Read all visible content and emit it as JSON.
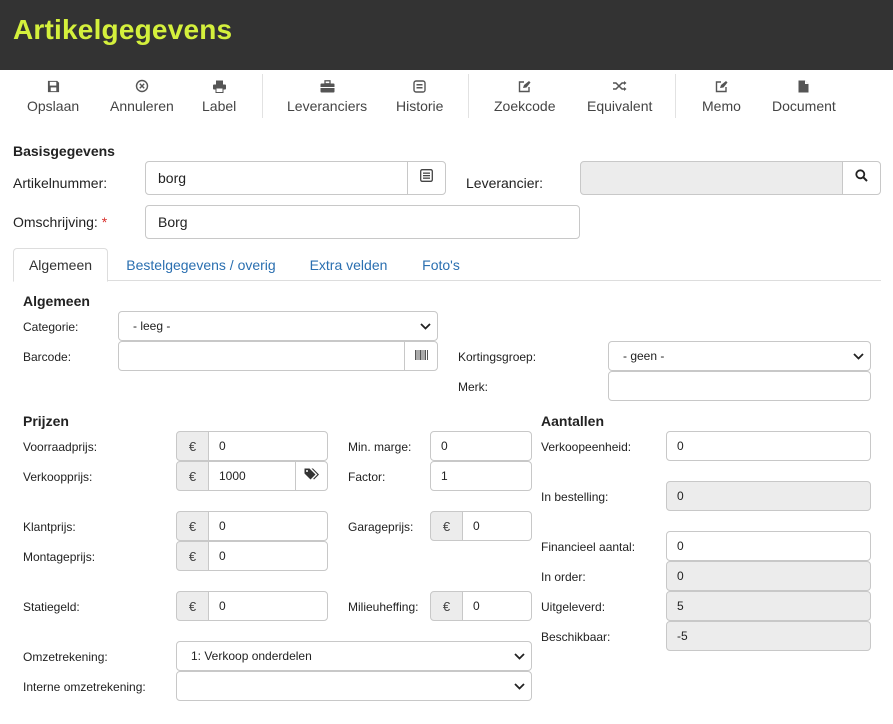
{
  "header": {
    "title": "Artikelgegevens"
  },
  "toolbar": {
    "save": "Opslaan",
    "cancel": "Annuleren",
    "label": "Label",
    "suppliers": "Leveranciers",
    "history": "Historie",
    "search_code": "Zoekcode",
    "equivalent": "Equivalent",
    "memo": "Memo",
    "document": "Document"
  },
  "basis": {
    "heading": "Basisgegevens",
    "article_number_label": "Artikelnummer:",
    "article_number_value": "borg",
    "supplier_label": "Leverancier:",
    "supplier_value": "",
    "description_label": "Omschrijving:",
    "required_mark": "*",
    "description_value": "Borg"
  },
  "tabs": {
    "general": "Algemeen",
    "order_data": "Bestelgegevens / overig",
    "extra_fields": "Extra velden",
    "photos": "Foto's"
  },
  "general": {
    "heading": "Algemeen",
    "category_label": "Categorie:",
    "category_value": "- leeg -",
    "barcode_label": "Barcode:",
    "barcode_value": "",
    "discount_group_label": "Kortingsgroep:",
    "discount_group_value": "- geen -",
    "brand_label": "Merk:",
    "brand_value": ""
  },
  "prices": {
    "heading": "Prijzen",
    "currency": "€",
    "stock_price_label": "Voorraadprijs:",
    "stock_price_value": "0",
    "sale_price_label": "Verkoopprijs:",
    "sale_price_value": "1000",
    "min_margin_label": "Min. marge:",
    "min_margin_value": "0",
    "factor_label": "Factor:",
    "factor_value": "1",
    "customer_price_label": "Klantprijs:",
    "customer_price_value": "0",
    "garage_price_label": "Garageprijs:",
    "garage_price_value": "0",
    "mounting_price_label": "Montageprijs:",
    "mounting_price_value": "0",
    "deposit_label": "Statiegeld:",
    "deposit_value": "0",
    "env_levy_label": "Milieuheffing:",
    "env_levy_value": "0",
    "revenue_account_label": "Omzetrekening:",
    "revenue_account_value": "1: Verkoop onderdelen",
    "internal_revenue_label": "Interne omzetrekening:",
    "internal_revenue_value": ""
  },
  "quantities": {
    "heading": "Aantallen",
    "sales_unit_label": "Verkoopeenheid:",
    "sales_unit_value": "0",
    "on_order_label": "In bestelling:",
    "on_order_value": "0",
    "financial_qty_label": "Financieel aantal:",
    "financial_qty_value": "0",
    "in_order_label": "In order:",
    "in_order_value": "0",
    "issued_label": "Uitgeleverd:",
    "issued_value": "5",
    "available_label": "Beschikbaar:",
    "available_value": "-5"
  },
  "colors": {
    "title": "#d4f03c",
    "header_bg": "#333333",
    "link": "#2a6fb0",
    "required": "#d9302c"
  }
}
